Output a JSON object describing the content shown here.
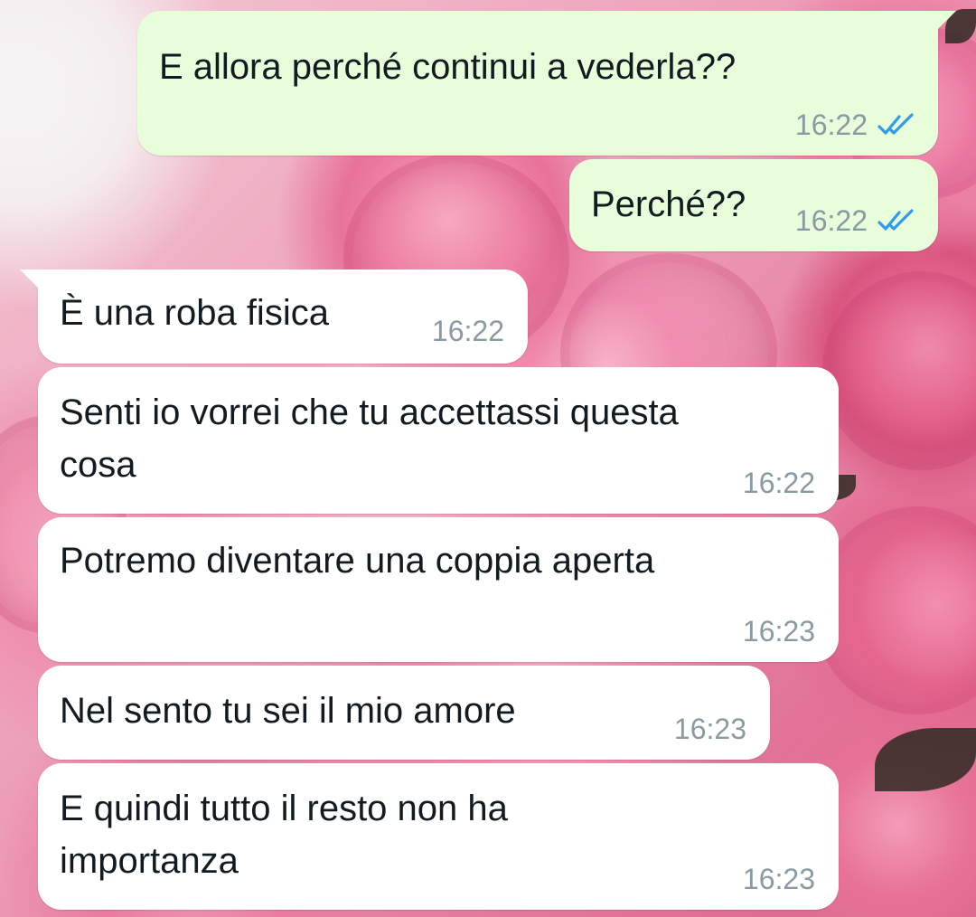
{
  "messages": [
    {
      "direction": "out",
      "text_lines": [
        "E allora perché continui a vederla??"
      ],
      "time": "16:22",
      "status": "read"
    },
    {
      "direction": "out",
      "text_lines": [
        "Perché??"
      ],
      "time": "16:22",
      "status": "read"
    },
    {
      "direction": "in",
      "text_lines": [
        "È una roba fisica"
      ],
      "time": "16:22"
    },
    {
      "direction": "in",
      "text_lines": [
        "Senti io vorrei che tu accettassi questa",
        "cosa"
      ],
      "time": "16:22"
    },
    {
      "direction": "in",
      "text_lines": [
        "Potremo diventare una coppia aperta"
      ],
      "time": "16:23"
    },
    {
      "direction": "in",
      "text_lines": [
        "Nel sento tu sei il mio amore"
      ],
      "time": "16:23"
    },
    {
      "direction": "in",
      "text_lines": [
        "E quindi tutto il resto non ha",
        "importanza"
      ],
      "time": "16:23"
    }
  ],
  "colors": {
    "outgoing_bubble": "#e8fdd9",
    "incoming_bubble": "#ffffff",
    "read_ticks": "#2c9cf0",
    "timestamp": "#8a9aa3"
  },
  "icons": {
    "read_status": "double-check-icon",
    "wallpaper": "pink-roses"
  }
}
